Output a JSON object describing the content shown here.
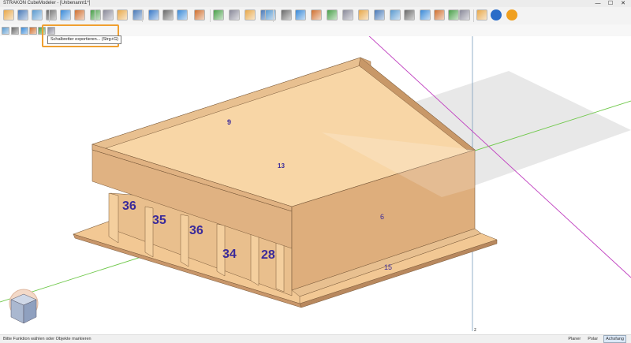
{
  "window": {
    "title": "STRAKON CubeModeler - [Unbenannt1*]",
    "minimize": "—",
    "maximize": "☐",
    "close": "✕"
  },
  "toolbar": {
    "icons": [
      "new-icon",
      "save-icon",
      "export-icon",
      "layers-icon",
      "cut-icon",
      "color-icon",
      "fill-icon",
      "settings-icon",
      "grid-icon",
      "cube-view-icon",
      "home-icon",
      "zoom-icon",
      "box-icon",
      "zoom-window-icon",
      "axis-icon",
      "rotate-icon",
      "move-icon",
      "scale-icon",
      "undo-icon",
      "redo-icon",
      "measure-icon",
      "snap-icon",
      "edit-icon",
      "delete-icon",
      "copy-icon",
      "mirror-icon",
      "join-icon",
      "split-icon",
      "array-icon",
      "brick-icon",
      "section-icon",
      "layer-stack-icon",
      "render-icon",
      "confirm-icon",
      "cancel-icon"
    ]
  },
  "toolbar2": {
    "icons": [
      "cube-small-icon",
      "list-icon",
      "cut-small-icon",
      "paint-icon",
      "rebar-icon",
      "formwork-export-icon"
    ]
  },
  "tooltip": {
    "text": "Schalbretter exportieren... (Strg+G)"
  },
  "model": {
    "labels": [
      "9",
      "13",
      "6",
      "36",
      "35",
      "36",
      "34",
      "28",
      "15"
    ]
  },
  "axis": {
    "z_label": "z"
  },
  "status": {
    "message": "Bitte Funktion wählen oder Objekte markieren",
    "modes": [
      "Planer",
      "Polar",
      "Achsfang"
    ],
    "active_mode": "Achsfang"
  },
  "colors": {
    "wood_top": "#f8d6a6",
    "wood_side": "#d9aa78",
    "label": "#3a2a9a",
    "x_axis": "#6fc84a",
    "y_axis": "#c040c0",
    "z_axis": "#6a8fb0",
    "ground": "#dedede"
  }
}
